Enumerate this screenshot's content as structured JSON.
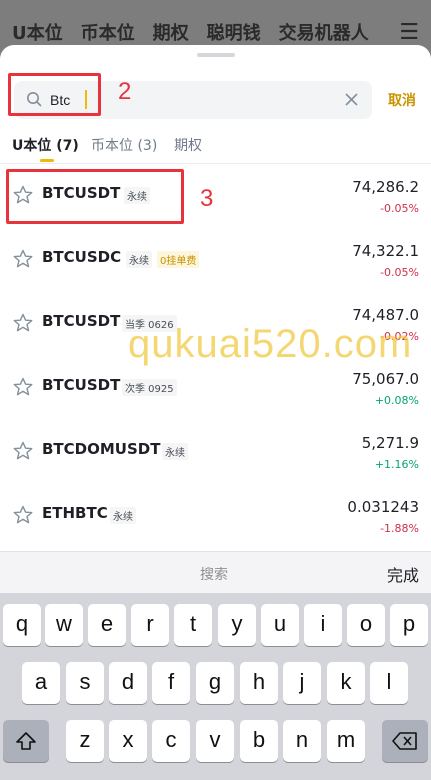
{
  "background_tabs": [
    "U本位",
    "币本位",
    "期权",
    "聪明钱",
    "交易机器人"
  ],
  "search": {
    "value": "Btc",
    "cancel_label": "取消"
  },
  "annotations": {
    "search_number": "2",
    "row_number": "3"
  },
  "tabs": [
    {
      "label": "U本位 (7)",
      "active": true
    },
    {
      "label": "币本位 (3)",
      "active": false
    },
    {
      "label": "期权",
      "active": false
    }
  ],
  "results": [
    {
      "symbol": "BTCUSDT",
      "tag": "永续",
      "tag_style": "gray",
      "price": "74,286.2",
      "change": "-0.05%",
      "direction": "down"
    },
    {
      "symbol": "BTCUSDC",
      "tag": "永续",
      "tag_style": "gray",
      "extra_tag": "0挂单费",
      "price": "74,322.1",
      "change": "-0.05%",
      "direction": "down"
    },
    {
      "symbol": "BTCUSDT",
      "tag": "当季 0626",
      "tag_style": "gray",
      "price": "74,487.0",
      "change": "-0.02%",
      "direction": "down"
    },
    {
      "symbol": "BTCUSDT",
      "tag": "次季 0925",
      "tag_style": "gray",
      "price": "75,067.0",
      "change": "+0.08%",
      "direction": "up"
    },
    {
      "symbol": "BTCDOMUSDT",
      "tag": "永续",
      "tag_style": "gray",
      "price": "5,271.9",
      "change": "+1.16%",
      "direction": "up"
    },
    {
      "symbol": "ETHBTC",
      "tag": "永续",
      "tag_style": "gray",
      "price": "0.031243",
      "change": "-1.88%",
      "direction": "down"
    }
  ],
  "watermark": "qukuai520.com",
  "keyboard": {
    "toolbar_label": "搜索",
    "done_label": "完成",
    "row1": [
      "q",
      "w",
      "e",
      "r",
      "t",
      "y",
      "u",
      "i",
      "o",
      "p"
    ],
    "row2": [
      "a",
      "s",
      "d",
      "f",
      "g",
      "h",
      "j",
      "k",
      "l"
    ],
    "row3": [
      "z",
      "x",
      "c",
      "v",
      "b",
      "n",
      "m"
    ],
    "icons": [
      "shift-icon",
      "delete-icon"
    ]
  },
  "colors": {
    "accent": "#f0b90b",
    "negative": "#cf304a",
    "positive": "#03a66d",
    "annotation": "#e8323c"
  }
}
